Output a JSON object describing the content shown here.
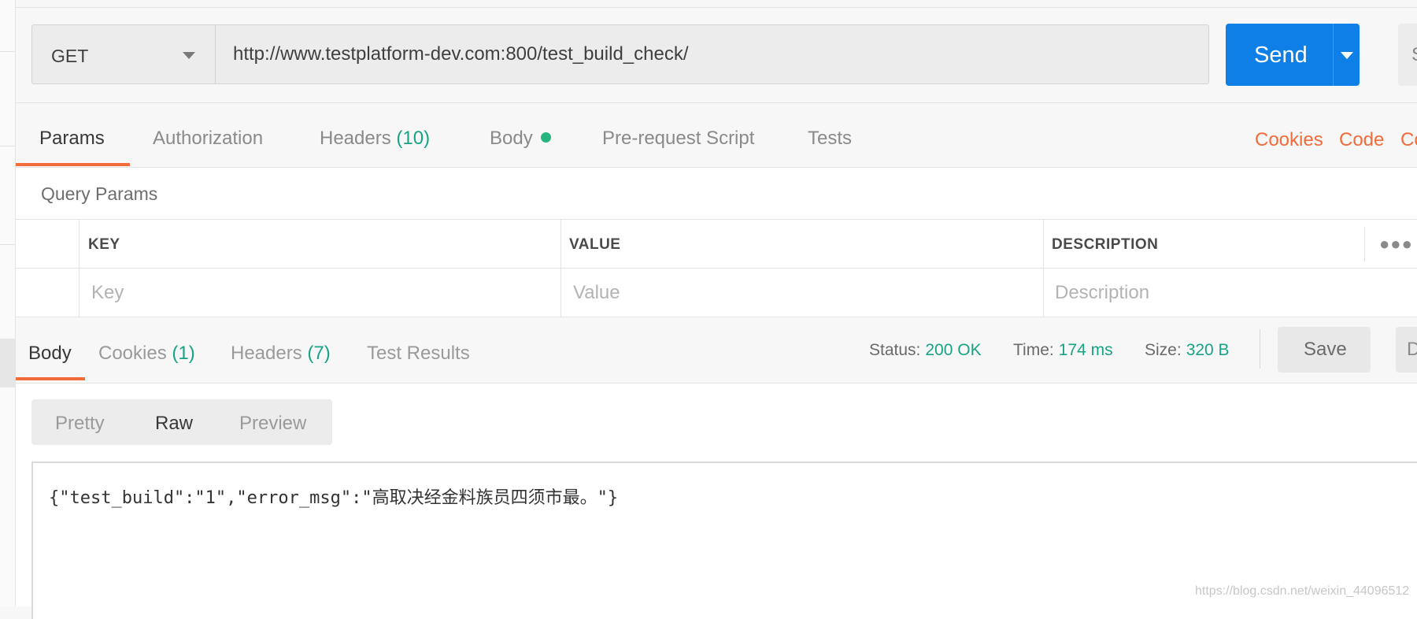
{
  "request": {
    "method": "GET",
    "url": "http://www.testplatform-dev.com:800/test_build_check/",
    "send_label": "Send",
    "save_partial": "S"
  },
  "request_tabs": [
    {
      "label": "Params",
      "active": true
    },
    {
      "label": "Authorization"
    },
    {
      "label": "Headers",
      "count": "(10)"
    },
    {
      "label": "Body",
      "indicator": "green-dot"
    },
    {
      "label": "Pre-request Script"
    },
    {
      "label": "Tests"
    }
  ],
  "request_links": [
    "Cookies",
    "Code",
    "Co"
  ],
  "query_params": {
    "title": "Query Params",
    "headers": [
      "KEY",
      "VALUE",
      "DESCRIPTION"
    ],
    "placeholders": [
      "Key",
      "Value",
      "Description"
    ],
    "more_icon": "more-horizontal-icon"
  },
  "response_tabs": [
    {
      "label": "Body",
      "active": true
    },
    {
      "label": "Cookies",
      "count": "(1)"
    },
    {
      "label": "Headers",
      "count": "(7)"
    },
    {
      "label": "Test Results"
    }
  ],
  "status": {
    "status_label": "Status:",
    "status_value": "200 OK",
    "time_label": "Time:",
    "time_value": "174 ms",
    "size_label": "Size:",
    "size_value": "320 B"
  },
  "response_actions": {
    "save": "Save",
    "extra_partial": "D"
  },
  "format_tabs": [
    {
      "label": "Pretty"
    },
    {
      "label": "Raw",
      "active": true
    },
    {
      "label": "Preview"
    }
  ],
  "response_body": "{\"test_build\":\"1\",\"error_msg\":\"高取决经金料族员四须市最。\"}",
  "watermark": "https://blog.csdn.net/weixin_44096512",
  "colors": {
    "accent": "#f26b3a",
    "send": "#0d7fe6",
    "success": "#19a386"
  }
}
